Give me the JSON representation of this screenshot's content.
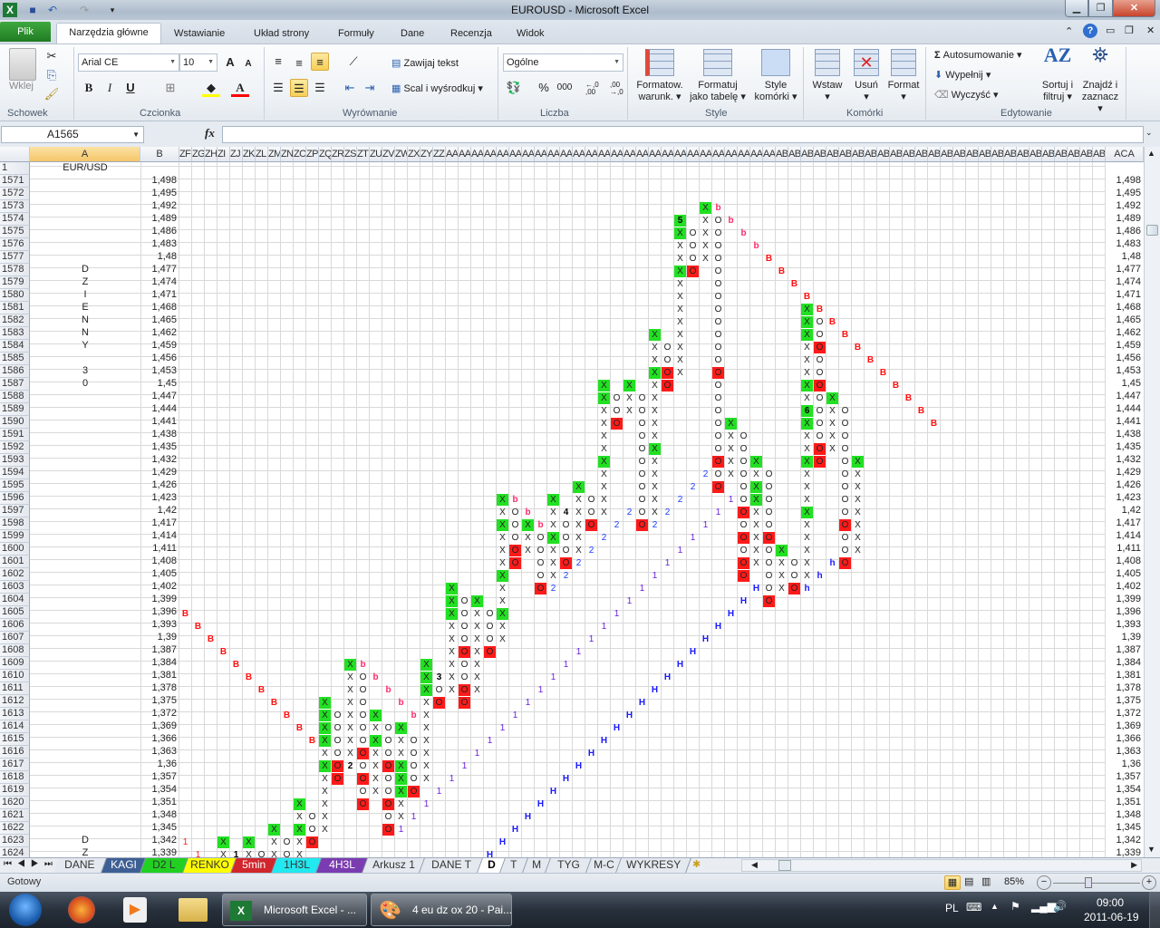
{
  "title": "EUROUSD  -  Microsoft Excel",
  "ribbon_tabs": {
    "file": "Plik",
    "home": "Narzędzia główne",
    "insert": "Wstawianie",
    "layout": "Układ strony",
    "formulas": "Formuły",
    "data": "Dane",
    "review": "Recenzja",
    "view": "Widok"
  },
  "clipboard": {
    "paste": "Wklej",
    "group": "Schowek"
  },
  "font": {
    "name": "Arial CE",
    "size": "10",
    "bold": "B",
    "italic": "I",
    "underline": "U",
    "grow": "A",
    "shrink": "A",
    "color_a": "A",
    "group": "Czcionka"
  },
  "alignment": {
    "wrap": "Zawijaj tekst",
    "merge": "Scal i wyśrodkuj",
    "group": "Wyrównanie"
  },
  "number": {
    "format": "Ogólne",
    "percent": "%",
    "thousands": "000",
    "inc": "←,0 ,00",
    "dec": ",00 →,0",
    "group": "Liczba"
  },
  "styles": {
    "cond1": "Formatow.",
    "cond2": "warunk.",
    "table1": "Formatuj",
    "table2": "jako tabelę",
    "cell1": "Style",
    "cell2": "komórki",
    "group": "Style"
  },
  "cells": {
    "insert": "Wstaw",
    "delete": "Usuń",
    "format": "Format",
    "group": "Komórki"
  },
  "editing": {
    "autosum": "Autosumowanie",
    "fill": "Wypełnij",
    "clear": "Wyczyść",
    "sort1": "Sortuj i",
    "sort2": "filtruj",
    "find1": "Znajdź i",
    "find2": "zaznacz",
    "group": "Edytowanie",
    "sigma": "Σ"
  },
  "formula_bar": {
    "name_box": "A1565",
    "fx": "fx",
    "value": ""
  },
  "sheet": {
    "col_a": "A",
    "col_b": "B",
    "col_last": "ACA",
    "row1_label": "1",
    "a1": "EUR/USD",
    "grid_columns": [
      "ZF",
      "ZG",
      "ZH",
      "ZI",
      "ZJ",
      "ZK",
      "ZL",
      "ZM",
      "ZN",
      "ZO",
      "ZP",
      "ZQ",
      "ZR",
      "ZS",
      "ZT",
      "ZU",
      "ZV",
      "ZW",
      "ZX",
      "ZY",
      "ZZ",
      "AAA",
      "AAB",
      "AAC",
      "AAD",
      "AAE",
      "AAF",
      "AAG",
      "AAH",
      "AAI",
      "AAJ",
      "AAK",
      "AAL",
      "AAM",
      "AAN",
      "AAO",
      "AAP",
      "AAQ",
      "AAR",
      "AAS",
      "AAT",
      "AAU",
      "AAV",
      "AAW",
      "AAX",
      "AAY",
      "AAZ",
      "ABA",
      "ABB",
      "ABC",
      "ABD",
      "ABE",
      "ABF",
      "ABG",
      "ABH",
      "ABI",
      "ABJ",
      "ABK",
      "ABL",
      "ABM",
      "ABN",
      "ABO",
      "ABP",
      "ABQ",
      "ABR",
      "ABS",
      "ABT",
      "ABU",
      "ABV",
      "ABW",
      "ABX",
      "ABY",
      "ABZ"
    ],
    "first_row": 1571,
    "prices": [
      "1,498",
      "1,495",
      "1,492",
      "1,489",
      "1,486",
      "1,483",
      "1,48",
      "1,477",
      "1,474",
      "1,471",
      "1,468",
      "1,465",
      "1,462",
      "1,459",
      "1,456",
      "1,453",
      "1,45",
      "1,447",
      "1,444",
      "1,441",
      "1,438",
      "1,435",
      "1,432",
      "1,429",
      "1,426",
      "1,423",
      "1,42",
      "1,417",
      "1,414",
      "1,411",
      "1,408",
      "1,405",
      "1,402",
      "1,399",
      "1,396",
      "1,393",
      "1,39",
      "1,387",
      "1,384",
      "1,381",
      "1,378",
      "1,375",
      "1,372",
      "1,369",
      "1,366",
      "1,363",
      "1,36",
      "1,357",
      "1,354",
      "1,351",
      "1,348",
      "1,345",
      "1,342",
      "1,339"
    ],
    "col_a_values": {
      "1578": "D",
      "1579": "Z",
      "1580": "I",
      "1581": "E",
      "1582": "N",
      "1583": "N",
      "1584": "Y",
      "1586": "3",
      "1587": "0",
      "1623": "D",
      "1624": "Z"
    }
  },
  "pf_legend": {
    "X": {
      "text": "X",
      "fill": "",
      "color": "#222"
    },
    "G": {
      "text": "X",
      "fill": "#22e022",
      "color": "#222"
    },
    "O": {
      "text": "O",
      "fill": "",
      "color": "#222"
    },
    "R": {
      "text": "O",
      "fill": "#ff1a1a",
      "color": "#222"
    },
    "5": {
      "text": "5",
      "fill": "#22e022",
      "color": "#000",
      "bold": true
    },
    "6": {
      "text": "6",
      "fill": "#22e022",
      "color": "#000",
      "bold": true
    },
    "3": {
      "text": "3",
      "fill": "",
      "color": "#000",
      "bold": true
    },
    "4": {
      "text": "4",
      "fill": "",
      "color": "#000",
      "bold": true
    },
    "z": {
      "text": "2",
      "fill": "",
      "color": "#000",
      "bold": true
    },
    "k": {
      "text": "1",
      "fill": "",
      "color": "#000",
      "bold": true
    },
    "2": {
      "text": "2",
      "fill": "",
      "color": "#1a3cff"
    },
    "1": {
      "text": "1",
      "fill": "",
      "color": "#6a1ee0"
    },
    "r": {
      "text": "1",
      "fill": "",
      "color": "#ff2020"
    },
    "B": {
      "text": "B",
      "fill": "",
      "color": "#ff1010",
      "bold": true
    },
    "b": {
      "text": "b",
      "fill": "",
      "color": "#ff2a6a",
      "bold": true
    },
    "H": {
      "text": "H",
      "fill": "",
      "color": "#1a1aff",
      "bold": true
    },
    "h": {
      "text": "h",
      "fill": "",
      "color": "#1a1aff",
      "bold": true
    }
  },
  "pf_rows": {
    "1573": "41G 42b",
    "1574": "395 41X 42O 43b",
    "1575": "39G 40O 41X 42O 44b",
    "1576": "39X 40O 41X 42O 45b",
    "1577": "39X 40O 41X 42O 46B",
    "1578": "39G 40R 42O 47B",
    "1579": "39X 42O 48B",
    "1580": "39X 42O 49B",
    "1581": "39X 42O 49G 50B",
    "1582": "39X 42O 49G 50O 51B",
    "1583": "37G 39X 42O 49G 50O 52B",
    "1584": "37X 38O 39X 42O 49X 50R 53B",
    "1585": "37X 38O 39X 42O 49X 50O 54B",
    "1586": "37G 38R 39X 42R 49X 50O 55B",
    "1587": "33G 35G 37X 38R 42O 49G 50R 56B",
    "1588": "33G 34O 35X 36O 37X 42O 49X 50O 51G 57B",
    "1589": "33X 34O 35X 36O 37X 42O 496 50O 51X 52O 58B",
    "1590": "33X 34R 36O 37X 42O 43G 49G 50O 51X 52O 59B",
    "1591": "33X 36O 37X 42O 43X 44O 49X 50O 51X 52O",
    "1592": "33X 36O 37G 42O 43X 44O 49X 50R 51X 52O",
    "1593": "33G 36O 37X 42R 43X 44O 45G 49G 50R 52O 53G",
    "1594": "33X 36O 37X 412 42O 43X 44O 45X 46O 49X 52O 53X",
    "1595": "31G 33X 36O 37X 402 42R 44O 45G 46O 49X 52O 53X",
    "1596": "25G 26b 29G 31X 32O 33X 36O 37X 392 431 44O 45G 46O 49X 52O 53X",
    "1597": "25X 26O 27b 29X 304 31X 32O 33X 352 36O 37X 382 421 44R 45X 46O 49G 52O 53X",
    "1598": "25G 26O 27G 28b 29X 30O 31X 32R 342 36R 372 411 44O 45X 46O 49X 52R 53X",
    "1599": "25X 26O 27X 28O 29G 30O 31X 332 401 44R 45X 46R 49X 52O 53X",
    "1600": "25X 26R 27X 28O 29X 30O 31X 322 391 44O 45X 46O 47G 49X 52O 53X",
    "1601": "25X 26R 28O 29X 30R 312 381 44R 45X 46O 47X 48O 49X 51h 52R",
    "1602": "25G 28O 29X 302 371 44R 46O 47X 48O 49X 50h",
    "1603": "21G 25X 28R 292 361 45H 46O 47X 48R 49h",
    "1604": "21G 22O 23G 25X 351 44H 46R",
    "1605": "0B 21G 22O 23X 24O 25G 341 43H",
    "1606": "1B 21X 22O 23X 24O 25X 331 42H",
    "1607": "2B 21X 22O 23X 24O 25X 321 41H",
    "1608": "3B 21X 22R 23X 24R 311 40H",
    "1609": "4B 13G 14b 19G 21X 22O 23X 301 39H",
    "1610": "5B 13X 14O 15b 19G 203 21X 22O 23X 291 38H",
    "1611": "6B 13X 14O 16b 19G 20O 21X 22R 23X 281 37H",
    "1612": "7B 11G 13X 14O 17b 19X 20R 22R 271 36H",
    "1613": "8B 11G 12O 13X 14O 15G 18b 19X 261 35H",
    "1614": "9B 11G 12O 13X 14O 15X 16O 17G 19X 251 34H",
    "1615": "10B 11G 12O 13X 14O 15G 16O 17X 18O 19X 241 33H",
    "1616": "11X 12O 13X 14R 15X 16O 17X 18O 19X 231 32H",
    "1617": "11G 12R 13z 14O 15X 16R 17G 18O 19X 221 31H",
    "1618": "11X 12R 14R 15X 16O 17G 18O 19X 211 30H",
    "1619": "11X 14O 15X 16O 17G 18R 201 29H",
    "1620": "9G 11X 14R 16R 17X 191 28H",
    "1621": "9X 10O 11X 16O 17X 181 27H",
    "1622": "7G 9G 10O 11X 16R 171 26H",
    "1623": "0r 3G 5G 7X 8O 9X 10R 25H",
    "1624": "1r 3X 4k 5X 6O 7X 8O 9X 24H"
  },
  "sheet_tabs": [
    {
      "name": "DANE",
      "color": ""
    },
    {
      "name": "KAGI",
      "color": "#3e5f93"
    },
    {
      "name": "D2 L",
      "color": "#22d022"
    },
    {
      "name": "RENKO",
      "color": "#ffff00"
    },
    {
      "name": "5min",
      "color": "#d0262c"
    },
    {
      "name": "1H3L",
      "color": "#22e8f0"
    },
    {
      "name": "4H3L",
      "color": "#7a3cb0"
    },
    {
      "name": "Arkusz 1",
      "color": ""
    },
    {
      "name": "DANE T",
      "color": ""
    },
    {
      "name": "D",
      "color": "",
      "active": true
    },
    {
      "name": "T",
      "color": ""
    },
    {
      "name": "M",
      "color": ""
    },
    {
      "name": "TYG",
      "color": ""
    },
    {
      "name": "M-C",
      "color": ""
    },
    {
      "name": "WYKRESY",
      "color": ""
    }
  ],
  "status": {
    "ready": "Gotowy",
    "zoom": "85%"
  },
  "taskbar": {
    "excel": "Microsoft Excel - ...",
    "paint": "4 eu dz ox 20 - Pai...",
    "lang": "PL",
    "time": "09:00",
    "date": "2011-06-19"
  }
}
